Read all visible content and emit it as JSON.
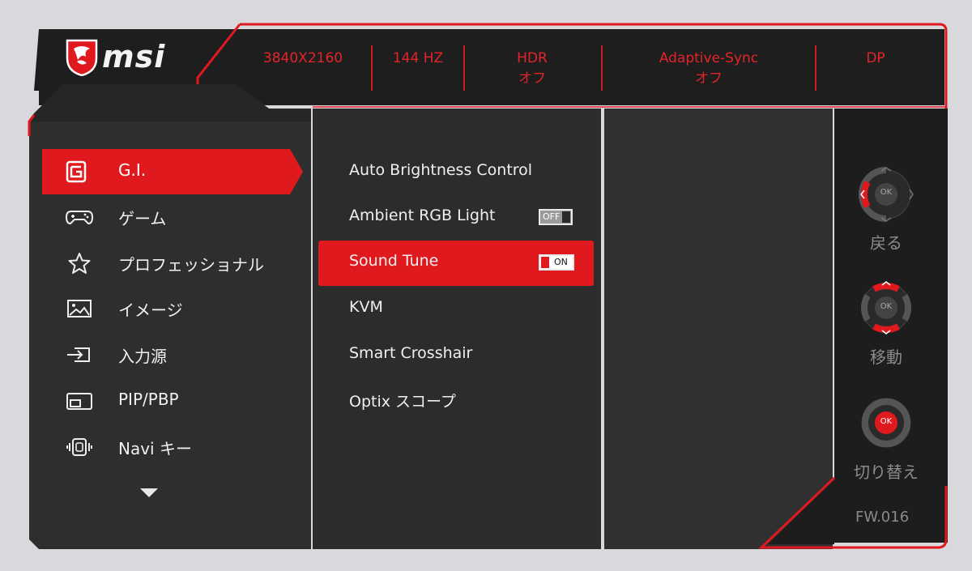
{
  "brand": {
    "logo_text": "msi"
  },
  "status_bar": [
    {
      "line1": "3840X2160",
      "line2": ""
    },
    {
      "line1": "144 HZ",
      "line2": ""
    },
    {
      "line1": "HDR",
      "line2": "オフ"
    },
    {
      "line1": "Adaptive-Sync",
      "line2": "オフ"
    },
    {
      "line1": "DP",
      "line2": ""
    }
  ],
  "main_menu": [
    {
      "label": "G.I.",
      "icon": "gi-icon",
      "active": true
    },
    {
      "label": "ゲーム",
      "icon": "gamepad-icon",
      "active": false
    },
    {
      "label": "プロフェッショナル",
      "icon": "star-icon",
      "active": false
    },
    {
      "label": "イメージ",
      "icon": "image-icon",
      "active": false
    },
    {
      "label": "入力源",
      "icon": "input-source-icon",
      "active": false
    },
    {
      "label": "PIP/PBP",
      "icon": "pip-pbp-icon",
      "active": false
    },
    {
      "label": "Navi キー",
      "icon": "navi-key-icon",
      "active": false
    }
  ],
  "sub_menu": [
    {
      "label": "Auto Brightness Control",
      "toggle": null,
      "selected": false
    },
    {
      "label": "Ambient RGB Light",
      "toggle": "OFF",
      "selected": false
    },
    {
      "label": "Sound Tune",
      "toggle": "ON",
      "selected": true
    },
    {
      "label": "KVM",
      "toggle": null,
      "selected": false
    },
    {
      "label": "Smart Crosshair",
      "toggle": null,
      "selected": false
    },
    {
      "label": "Optix スコープ",
      "toggle": null,
      "selected": false
    }
  ],
  "nav_guide": {
    "back_label": "戻る",
    "move_label": "移動",
    "select_label": "切り替え",
    "ok_label": "OK"
  },
  "firmware": "FW.016",
  "colors": {
    "accent": "#e01a22",
    "panel": "#2b2b2b",
    "panel_dark": "#1e1e1e",
    "background": "#d9d8dc"
  }
}
